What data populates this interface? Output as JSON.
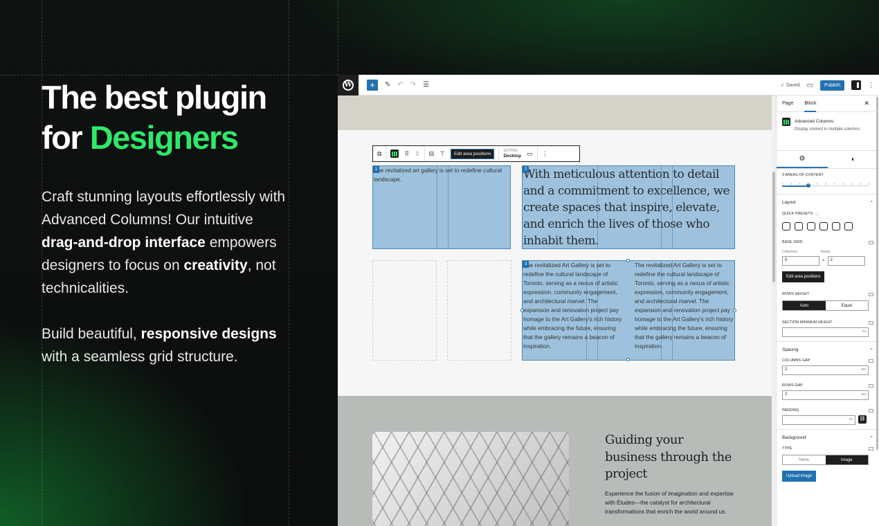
{
  "hero": {
    "title_line1": "The best plugin",
    "title_for": "for ",
    "title_accent": "Designers",
    "p1_a": "Craft stunning layouts effortlessly with Advanced Columns! Our intuitive ",
    "p1_b": "drag-and-drop interface",
    "p1_c": " empowers designers to focus on ",
    "p1_d": "creativity",
    "p1_e": ", not technicalities.",
    "p2_a": "Build beautiful, ",
    "p2_b": "responsive designs",
    "p2_c": " with a seamless grid structure."
  },
  "topbar": {
    "wp_logo": "W",
    "saved": "✓ Saved",
    "publish": "Publish"
  },
  "block_toolbar": {
    "edit_positions": "Edit area positions",
    "editing_label": "EDITING:",
    "editing_value": "Desktop",
    "more": "⋮"
  },
  "areas": {
    "a1_num": "1",
    "a1_text": "The revitalized art gallery is set to redefine cultural landscape.",
    "a2_num": "2",
    "a2_text": "With meticulous attention to detail and a commitment to excellence, we create spaces that inspire, elevate, and enrich the lives of those who inhabit them.",
    "a3_num": "3",
    "a3_col1": "The revitalized Art Gallery is set to redefine the cultural landscape of Toronto, serving as a nexus of artistic expression, community engagement, and architectural marvel. The expansion and renovation project pay homage to the Art Gallery's rich history while embracing the future, ensuring that the gallery remains a beacon of inspiration.",
    "a3_col2": "The revitalized Art Gallery is set to redefine the cultural landscape of Toronto, serving as a nexus of artistic expression, community engagement, and architectural marvel. The expansion and renovation project pay homage to the Art Gallery's rich history while embracing the future, ensuring that the gallery remains a beacon of inspiration."
  },
  "lower": {
    "title": "Guiding your business through the project",
    "desc": "Experience the fusion of imagination and expertise with Études—the catalyst for architectural transformations that enrich the world around us."
  },
  "sidebar": {
    "tab_page": "Page",
    "tab_block": "Block",
    "close": "✕",
    "block_name": "Advanced Columns",
    "block_desc": "Display content in multiple columns.",
    "subtab_settings": "⚙",
    "subtab_styles": "◐",
    "areas_label": "3 AREAS OF CONTENT",
    "areas_value": 3,
    "areas_max": 10,
    "layout": "Layout",
    "quick_presets": "QUICK PRESETS",
    "base_grid": "BASE GRID",
    "columns_label": "Columns",
    "rows_label": "Rows",
    "columns_value": "5",
    "times": "×",
    "rows_value": "2",
    "edit_positions": "Edit area positions",
    "rows_height": "ROWS HEIGHT",
    "auto": "Auto",
    "equal": "Equal",
    "section_min_height": "SECTION MINIMUM HEIGHT",
    "px": "Px",
    "spacing": "Spacing",
    "columns_gap": "COLUMNS GAP",
    "columns_gap_value": "2",
    "em": "EM",
    "rows_gap": "ROWS GAP",
    "rows_gap_value": "2",
    "padding": "PADDING",
    "background": "Background",
    "type": "TYPE",
    "none": "None",
    "image": "Image",
    "upload": "Upload image"
  },
  "colors": {
    "accent": "#2ee86a",
    "wp_blue": "#2271b1",
    "area_fill": "#6ea6d0"
  }
}
